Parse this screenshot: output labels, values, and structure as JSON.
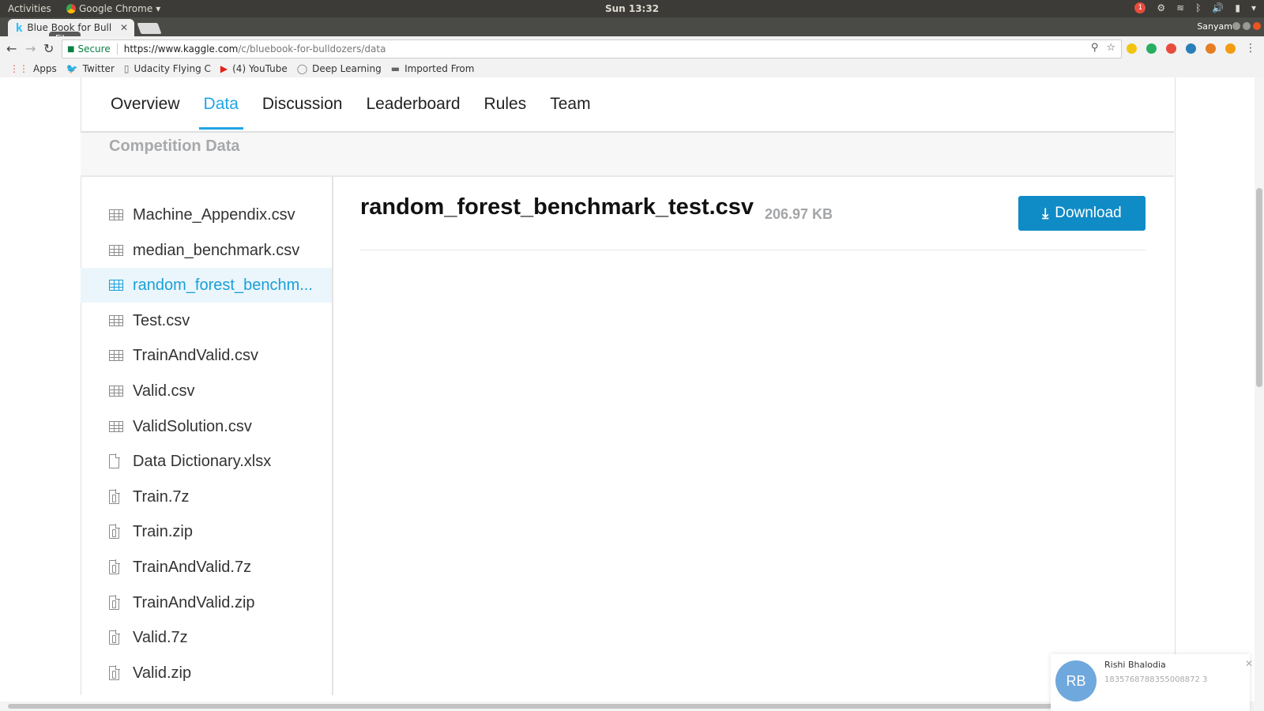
{
  "os": {
    "activities": "Activities",
    "app_name": "Google Chrome",
    "clock": "Sun 13:32"
  },
  "browser": {
    "tab_title": "Blue Book for Bull",
    "tooltip": "Files",
    "profile": "Sanyam",
    "secure_label": "Secure",
    "url_host": "https://www.kaggle.com",
    "url_path": "/c/bluebook-for-bulldozers/data"
  },
  "bookmarks": [
    {
      "label": "Apps",
      "icon": "apps-grid-icon"
    },
    {
      "label": "Twitter",
      "icon": "twitter-icon"
    },
    {
      "label": "Udacity Flying C",
      "icon": "page-icon"
    },
    {
      "label": "(4) YouTube",
      "icon": "youtube-icon"
    },
    {
      "label": "Deep Learning",
      "icon": "chat-icon"
    },
    {
      "label": "Imported From",
      "icon": "folder-icon"
    }
  ],
  "nav": {
    "tabs": [
      "Overview",
      "Data",
      "Discussion",
      "Leaderboard",
      "Rules",
      "Team"
    ],
    "active": "Data"
  },
  "section_title": "Competition Data",
  "files": [
    {
      "name": "Machine_Appendix.csv",
      "type": "table"
    },
    {
      "name": "median_benchmark.csv",
      "type": "table"
    },
    {
      "name": "random_forest_benchm...",
      "type": "table",
      "selected": true
    },
    {
      "name": "Test.csv",
      "type": "table"
    },
    {
      "name": "TrainAndValid.csv",
      "type": "table"
    },
    {
      "name": "Valid.csv",
      "type": "table"
    },
    {
      "name": "ValidSolution.csv",
      "type": "table"
    },
    {
      "name": "Data Dictionary.xlsx",
      "type": "doc"
    },
    {
      "name": "Train.7z",
      "type": "zip"
    },
    {
      "name": "Train.zip",
      "type": "zip"
    },
    {
      "name": "TrainAndValid.7z",
      "type": "zip"
    },
    {
      "name": "TrainAndValid.zip",
      "type": "zip"
    },
    {
      "name": "Valid.7z",
      "type": "zip"
    },
    {
      "name": "Valid.zip",
      "type": "zip"
    }
  ],
  "content": {
    "title": "random_forest_benchmark_test.csv",
    "size": "206.97 KB",
    "download_label": "Download"
  },
  "chat_toast": {
    "initials": "RB",
    "name": "Rishi Bhalodia",
    "subtitle": "1835768788355008872 3"
  },
  "colors": {
    "accent": "#20a5e6",
    "download": "#0f8bc6",
    "selected_bg": "#eaf6fb"
  }
}
